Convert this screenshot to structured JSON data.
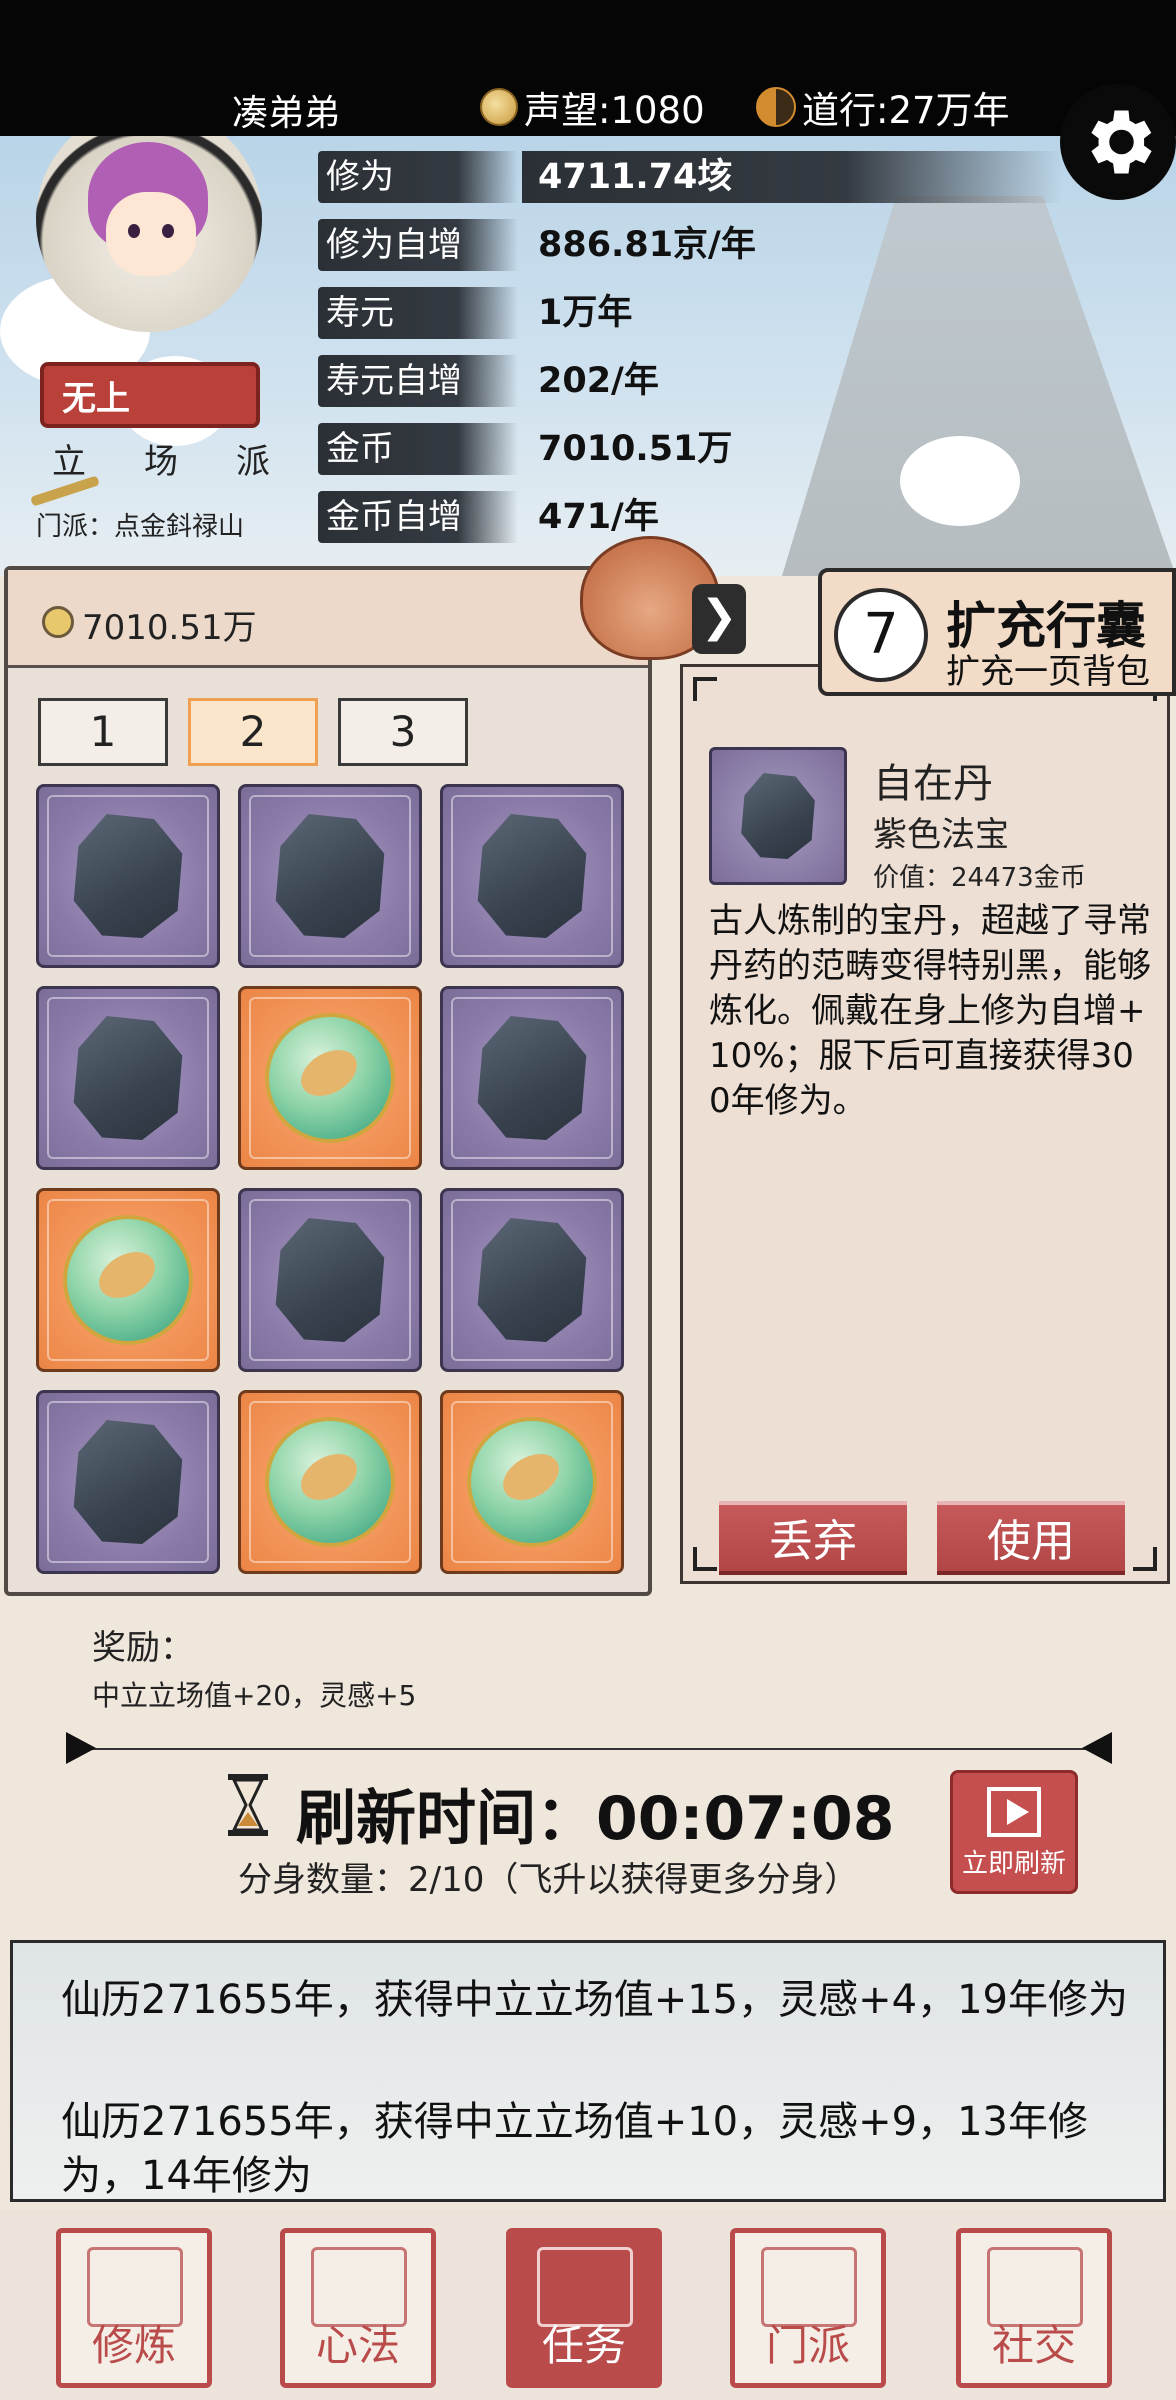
{
  "top": {
    "player_name": "凑弟弟",
    "reputation": "声望:1080",
    "daoxing": "道行:27万年",
    "settings_icon": "gear-icon"
  },
  "profile": {
    "rank_badge": "无上",
    "stance": "立场派",
    "sect": "门派：点金鈄禄山"
  },
  "stats": [
    {
      "label": "修为",
      "value": "4711.74垓"
    },
    {
      "label": "修为自增",
      "value": "886.81京/年"
    },
    {
      "label": "寿元",
      "value": "1万年"
    },
    {
      "label": "寿元自增",
      "value": "202/年"
    },
    {
      "label": "金币",
      "value": "7010.51万"
    },
    {
      "label": "金币自增",
      "value": "471/年"
    }
  ],
  "bag": {
    "coins": "7010.51万",
    "tabs": [
      "1",
      "2",
      "3"
    ],
    "active_tab": 1,
    "slots": [
      "rock",
      "rock",
      "rock",
      "rock",
      "orb",
      "rock",
      "orb",
      "rock",
      "rock",
      "rock",
      "orb",
      "orb"
    ]
  },
  "expand": {
    "count": "7",
    "title": "扩充行囊",
    "subtitle": "扩充一页背包"
  },
  "item": {
    "name": "自在丹",
    "type": "紫色法宝",
    "value": "价值：24473金币",
    "description": "古人炼制的宝丹，超越了寻常丹药的范畴变得特别黑，能够炼化。佩戴在身上修为自增+10%；服下后可直接获得300年修为。",
    "discard_label": "丢弃",
    "use_label": "使用"
  },
  "task": {
    "reward_label": "奖励：",
    "reward_text": "中立立场值+20，灵感+5",
    "refresh_time": "刷新时间：00:07:08",
    "clones": "分身数量：2/10（飞升以获得更多分身）",
    "refresh_now": "立即刷新"
  },
  "log": [
    "仙历271655年，获得中立立场值+15，灵感+4，19年修为",
    "仙历271655年，获得中立立场值+10，灵感+9，13年修为，14年修为"
  ],
  "nav": [
    {
      "label": "修炼",
      "icon": "mountain-icon"
    },
    {
      "label": "心法",
      "icon": "scroll-icon"
    },
    {
      "label": "任务",
      "icon": "task-scroll-icon"
    },
    {
      "label": "门派",
      "icon": "temple-icon"
    },
    {
      "label": "社交",
      "icon": "people-icon"
    }
  ],
  "nav_active": 2,
  "colors": {
    "accent_red": "#b94b4b",
    "purple_slot": "#8a7aa9",
    "orange_slot": "#f29357"
  }
}
